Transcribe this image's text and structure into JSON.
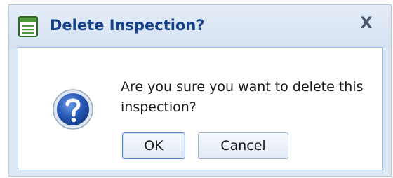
{
  "dialog": {
    "title": "Delete Inspection?",
    "close_label": "X",
    "title_icon": "window-form-icon",
    "message_icon": "question-mark-icon",
    "message": "Are you sure you want to delete this inspection?",
    "buttons": {
      "ok_label": "OK",
      "cancel_label": "Cancel"
    }
  },
  "colors": {
    "title_text": "#15428b",
    "frame": "#dce7f4",
    "body_border": "#99bbe8",
    "icon_green": "#4c9a3a",
    "question_blue": "#1f4fa8"
  }
}
